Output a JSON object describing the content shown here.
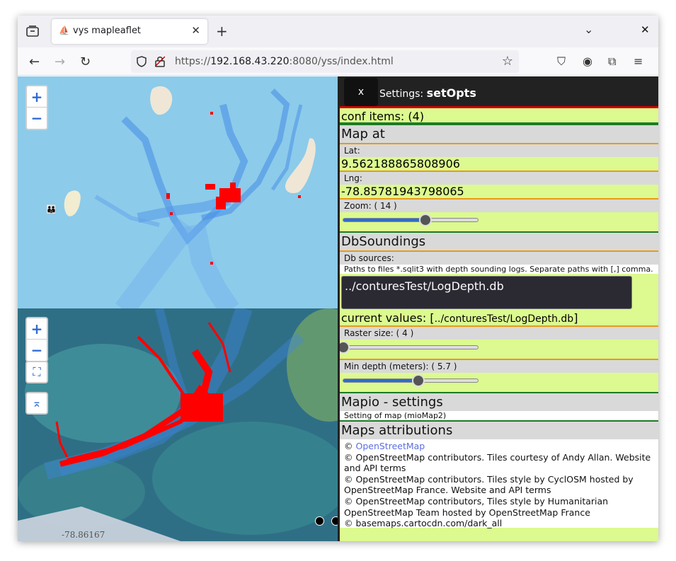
{
  "browser": {
    "tab_title": "vys mapleaflet",
    "url_prefix": "https://",
    "url_host": "192.168.43.220",
    "url_rest": ":8080/yss/index.html"
  },
  "map": {
    "coord_label": "-78.86167"
  },
  "panel": {
    "close_label": "x",
    "settings_label": "Settings:",
    "settings_name": "setOpts",
    "conf_items": "conf items: (4)",
    "map_at": {
      "title": "Map at",
      "lat_label": "Lat:",
      "lat_value": "9.562188865808906",
      "lng_label": "Lng:",
      "lng_value": "-78.85781943798065",
      "zoom_label": "Zoom: ( 14 )",
      "zoom_fraction": 0.61
    },
    "db": {
      "title": "DbSoundings",
      "sources_label": "Db sources:",
      "sources_note": "Paths to files *.sqlit3 with depth sounding logs. Separate paths with [,] comma.",
      "sources_value": "../conturesTest/LogDepth.db",
      "current_prefix": "current values: [",
      "current_value": "../conturesTest/LogDepth.db",
      "current_suffix": "]",
      "raster_label": "Raster size: ( 4 )",
      "raster_fraction": 0.0,
      "mindepth_label": "Min depth (meters): ( 5.7 )",
      "mindepth_fraction": 0.56
    },
    "mapio": {
      "title": "Mapio - settings",
      "note": "Setting of map (mioMap2)"
    },
    "attrib": {
      "title": "Maps attributions",
      "copy": "©",
      "osm_link": "OpenStreetMap",
      "line1": "© OpenStreetMap contributors. Tiles courtesy of Andy Allan. Website and API terms",
      "line2": "© OpenStreetMap contributors. Tiles style by CyclOSM hosted by OpenStreetMap France. Website and API terms",
      "line3": "© OpenStreetMap contributors, Tiles style by Humanitarian OpenStreetMap Team hosted by OpenStreetMap France",
      "line4": "© basemaps.cartocdn.com/dark_all"
    }
  }
}
